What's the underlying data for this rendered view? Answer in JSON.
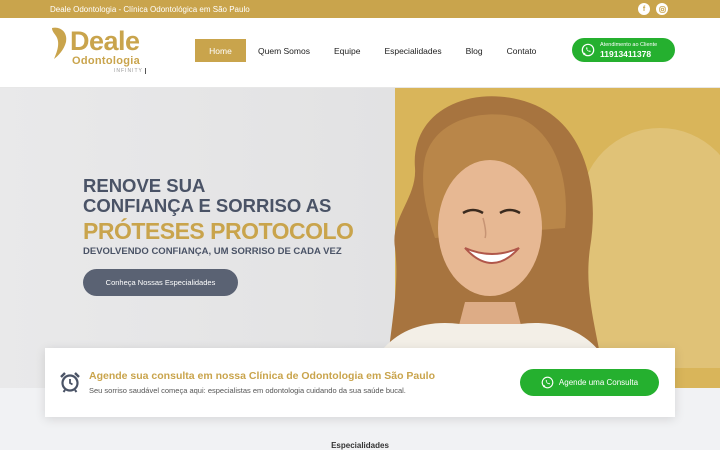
{
  "topbar": {
    "text": "Deale Odontologia - Clínica Odontológica em São Paulo"
  },
  "logo": {
    "name": "Deale",
    "sub": "Odontologia",
    "tag": "INFINITY"
  },
  "nav": {
    "items": [
      {
        "label": "Home"
      },
      {
        "label": "Quem Somos"
      },
      {
        "label": "Equipe"
      },
      {
        "label": "Especialidades"
      },
      {
        "label": "Blog"
      },
      {
        "label": "Contato"
      }
    ]
  },
  "header_whatsapp": {
    "label": "Atendimento ao Cliente",
    "phone": "11913411378"
  },
  "hero": {
    "line1": "RENOVE SUA",
    "line2": "CONFIANÇA E SORRISO AS",
    "line3": "PRÓTESES PROTOCOLO",
    "subtitle": "DEVOLVENDO CONFIANÇA, UM SORRISO DE CADA VEZ",
    "cta": "Conheça Nossas Especialidades"
  },
  "card": {
    "title": "Agende sua consulta em nossa Clínica de Odontologia em São Paulo",
    "subtitle": "Seu sorriso saudável começa aqui: especialistas em odontologia cuidando da sua saúde bucal.",
    "button": "Agende uma Consulta"
  },
  "section": {
    "label": "Especialidades"
  },
  "colors": {
    "gold": "#c9a44c",
    "slate": "#4a5366",
    "whatsapp": "#25b02f"
  },
  "icons": [
    "facebook-icon",
    "instagram-icon",
    "whatsapp-icon",
    "alarm-clock-icon"
  ]
}
